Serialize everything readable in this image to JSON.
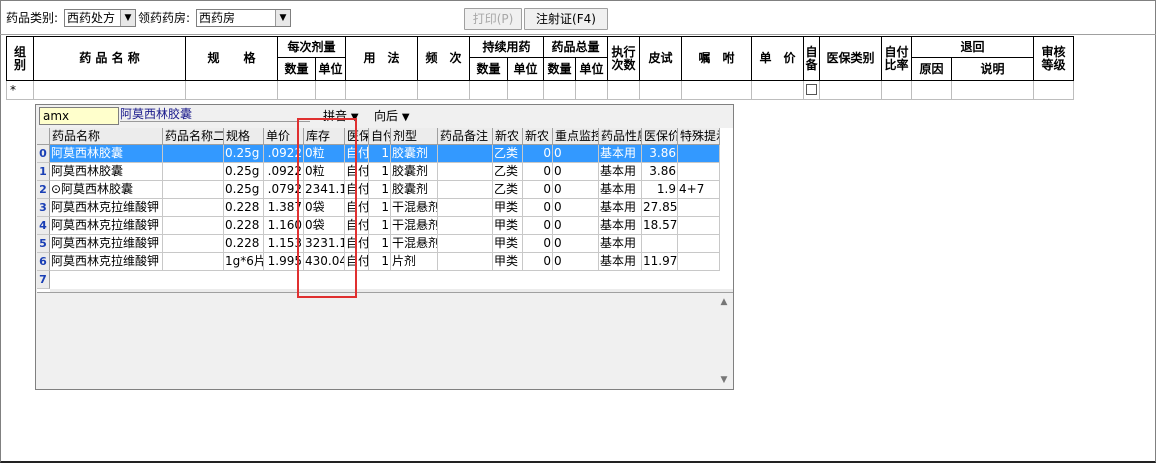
{
  "toolbar": {
    "category_label": "药品类别:",
    "category_value": "西药处方",
    "pharmacy_label": "领药药房:",
    "pharmacy_value": "西药房",
    "print_label": "打印(P)",
    "injection_label": "注射证(F4)"
  },
  "header": {
    "group": "组\n别",
    "drug_name": "药 品 名 称",
    "spec": "规　　格",
    "per_dose": "每次剂量",
    "per_dose_qty": "数量",
    "per_dose_unit": "单位",
    "usage": "用　法",
    "frequency": "频　次",
    "continuous": "持续用药",
    "continuous_qty": "数量",
    "continuous_unit": "单位",
    "total": "药品总量",
    "total_qty": "数量",
    "total_unit": "单位",
    "exec_times": "执行\n次数",
    "skin_test": "皮试",
    "instruction": "嘱　咐",
    "unit_price": "单　价",
    "self_prepared": "自\n备",
    "insurance_type": "医保类别",
    "self_pay_ratio": "自付\n比率",
    "return": "退回",
    "return_reason": "原因",
    "return_note": "说明",
    "audit_level": "审核\n等级",
    "new_row_marker": "*"
  },
  "popup": {
    "search_value": "amx",
    "selected_name": "阿莫西林胶囊",
    "pinyin_label": "拼音",
    "direction_label": "向后",
    "columns": [
      "药品名称",
      "药品名称二",
      "规格",
      "单价",
      "库存",
      "医保",
      "自付",
      "剂型",
      "药品备注",
      "新农",
      "新农",
      "重点监控",
      "药品性质",
      "医保价",
      "特殊提示"
    ],
    "rows": [
      [
        "0",
        "阿莫西林胶囊",
        "",
        "0.25g",
        ".0922",
        "0粒",
        "自付",
        "1",
        "胶囊剂",
        "",
        "乙类",
        "0",
        "0",
        "基本用",
        "3.86",
        ""
      ],
      [
        "1",
        "阿莫西林胶囊",
        "",
        "0.25g",
        ".0922",
        "0粒",
        "自付",
        "1",
        "胶囊剂",
        "",
        "乙类",
        "0",
        "0",
        "基本用",
        "3.86",
        ""
      ],
      [
        "2",
        "⊙阿莫西林胶囊",
        "",
        "0.25g",
        ".0792",
        "2341.1",
        "自付",
        "1",
        "胶囊剂",
        "",
        "乙类",
        "0",
        "0",
        "基本用",
        "1.9",
        "4+7"
      ],
      [
        "3",
        "阿莫西林克拉维酸钾",
        "",
        "0.228",
        "1.387",
        "0袋",
        "自付",
        "1",
        "干混悬剂",
        "",
        "甲类",
        "0",
        "0",
        "基本用",
        "27.85",
        ""
      ],
      [
        "4",
        "阿莫西林克拉维酸钾",
        "",
        "0.228",
        "1.160",
        "0袋",
        "自付",
        "1",
        "干混悬剂",
        "",
        "甲类",
        "0",
        "0",
        "基本用",
        "18.57",
        ""
      ],
      [
        "5",
        "阿莫西林克拉维酸钾",
        "",
        "0.228",
        "1.153",
        "3231.1",
        "自付",
        "1",
        "干混悬剂",
        "",
        "甲类",
        "0",
        "0",
        "基本用",
        "",
        ""
      ],
      [
        "6",
        "阿莫西林克拉维酸钾",
        "",
        "1g*6片",
        "1.995",
        "430.04",
        "自付",
        "1",
        "片剂",
        "",
        "甲类",
        "0",
        "0",
        "基本用",
        "11.97",
        ""
      ],
      [
        "7",
        "",
        "",
        "",
        "",
        "",
        "",
        "",
        "",
        "",
        "",
        "",
        "",
        "",
        "",
        ""
      ]
    ]
  },
  "colors": {
    "selection": "#3399ff",
    "highlight_box": "#e03030",
    "row_number": "#1a3fb5"
  }
}
